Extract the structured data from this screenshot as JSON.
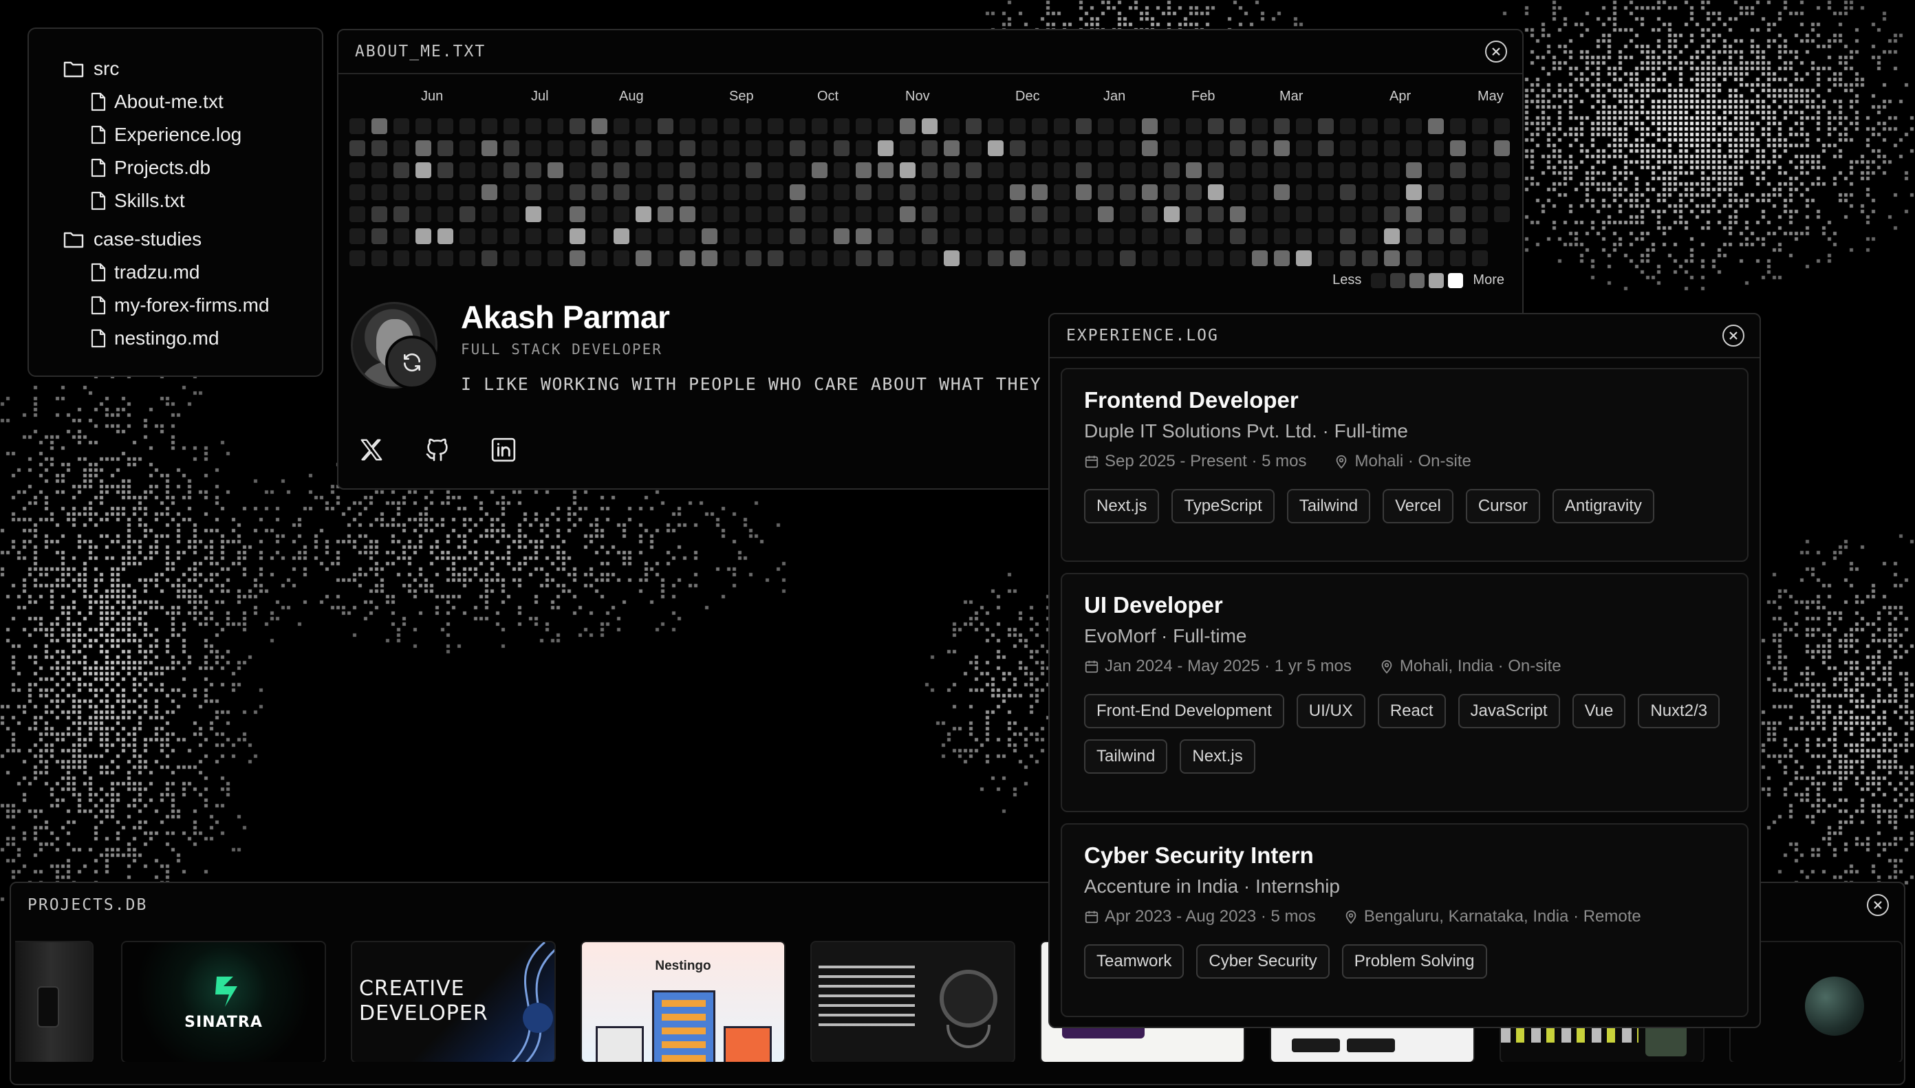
{
  "file_tree": {
    "folders": [
      {
        "name": "src",
        "files": [
          "About-me.txt",
          "Experience.log",
          "Projects.db",
          "Skills.txt"
        ]
      },
      {
        "name": "case-studies",
        "files": [
          "tradzu.md",
          "my-forex-firms.md",
          "nestingo.md"
        ]
      }
    ]
  },
  "about": {
    "title": "ABOUT_ME.TXT",
    "months": [
      "Jun",
      "Jul",
      "Aug",
      "Sep",
      "Oct",
      "Nov",
      "Dec",
      "Jan",
      "Feb",
      "Mar",
      "Apr",
      "May"
    ],
    "legend_less": "Less",
    "legend_more": "More",
    "name": "Akash Parmar",
    "role": "FULL STACK DEVELOPER",
    "tagline": "I LIKE WORKING WITH PEOPLE WHO CARE ABOUT WHAT THEY BUILD.",
    "socials": [
      "x-icon",
      "github-icon",
      "linkedin-icon"
    ]
  },
  "experience": {
    "title": "EXPERIENCE.LOG",
    "items": [
      {
        "title": "Frontend Developer",
        "company": "Duple IT Solutions Pvt. Ltd. · Full-time",
        "dates": "Sep 2025 - Present · 5 mos",
        "location": "Mohali · On-site",
        "skills": [
          "Next.js",
          "TypeScript",
          "Tailwind",
          "Vercel",
          "Cursor",
          "Antigravity"
        ]
      },
      {
        "title": "UI Developer",
        "company": "EvoMorf · Full-time",
        "dates": "Jan 2024 - May 2025 · 1 yr 5 mos",
        "location": "Mohali, India · On-site",
        "skills": [
          "Front-End Development",
          "UI/UX",
          "React",
          "JavaScript",
          "Vue",
          "Nuxt2/3",
          "Tailwind",
          "Next.js"
        ]
      },
      {
        "title": "Cyber Security Intern",
        "company": "Accenture in India · Internship",
        "dates": "Apr 2023 - Aug 2023 · 5 mos",
        "location": "Bengaluru, Karnataka, India · Remote",
        "skills": [
          "Teamwork",
          "Cyber Security",
          "Problem Solving"
        ]
      }
    ]
  },
  "projects": {
    "title": "PROJECTS.DB",
    "thumbnails": [
      {
        "name": "SINATRA"
      },
      {
        "name": "CREATIVE DEVELOPER"
      },
      {
        "name": "Nestingo"
      }
    ]
  },
  "colors": {
    "background": "#000000",
    "panel": "#050505",
    "border": "#2c2c2c",
    "heat_levels": [
      "#1c1c1c",
      "#3a3a3a",
      "#6a6a6a",
      "#a5a5a5",
      "#ffffff"
    ]
  }
}
